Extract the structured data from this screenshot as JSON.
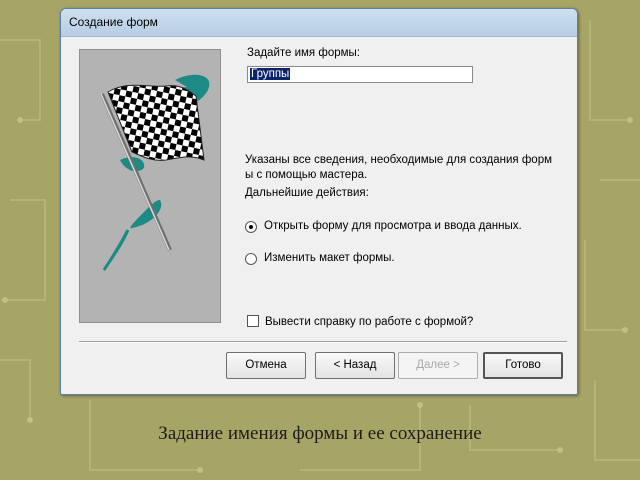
{
  "dialog": {
    "title": "Создание форм",
    "form_name_label": "Задайте имя формы:",
    "form_name_value": "Группы",
    "info_text_line1": "Указаны все сведения, необходимые для создания форм",
    "info_text_line2": "ы с помощью мастера.",
    "next_actions_label": "Дальнейшие действия:",
    "options": [
      {
        "label": "Открыть форму для просмотра и ввода данных.",
        "selected": true
      },
      {
        "label": "Изменить макет формы.",
        "selected": false
      }
    ],
    "help_checkbox_label": "Вывести справку по работе с формой?",
    "help_checkbox_checked": false,
    "buttons": {
      "cancel": "Отмена",
      "back": "< Назад",
      "next": "Далее >",
      "finish": "Готово"
    }
  },
  "caption": "Задание имения формы и ее сохранение",
  "colors": {
    "background": "#a7a566",
    "flag_accent": "#1e8a86",
    "selection": "#0a246a"
  },
  "icons": {
    "wizard_picture": "checkered-flag-icon"
  }
}
